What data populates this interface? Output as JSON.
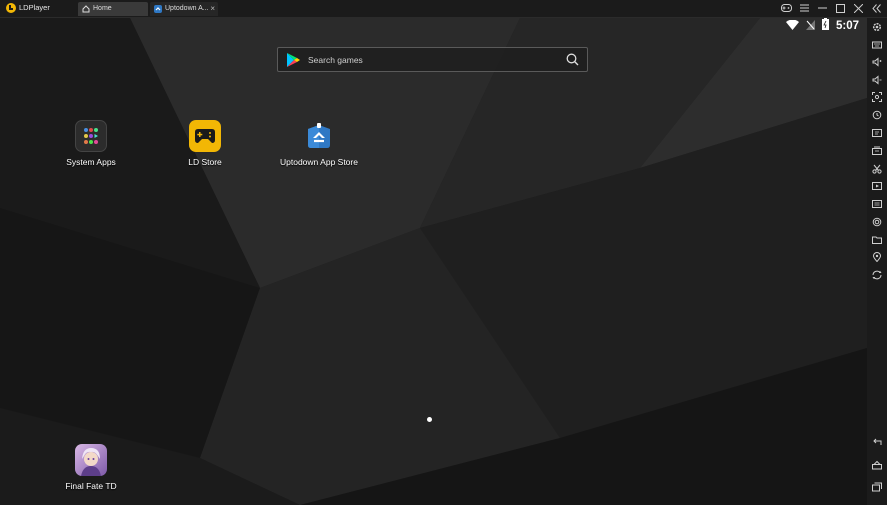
{
  "app": {
    "name": "LDPlayer"
  },
  "tabs": [
    {
      "label": "Home",
      "icon": "home-icon",
      "active": true
    },
    {
      "label": "Uptodown A...",
      "icon": "uptodown-icon",
      "active": false
    }
  ],
  "status": {
    "time": "5:07"
  },
  "search": {
    "placeholder": "Search games"
  },
  "apps": [
    {
      "label": "System Apps",
      "icon": "system-apps-icon"
    },
    {
      "label": "LD Store",
      "icon": "ld-store-icon"
    },
    {
      "label": "Uptodown App Store",
      "icon": "uptodown-icon"
    },
    {
      "label": "Final Fate TD",
      "icon": "final-fate-td-icon"
    }
  ],
  "colors": {
    "accent": "#f2b705",
    "background": "#1c1c1c",
    "uptodown": "#2f78c4"
  }
}
